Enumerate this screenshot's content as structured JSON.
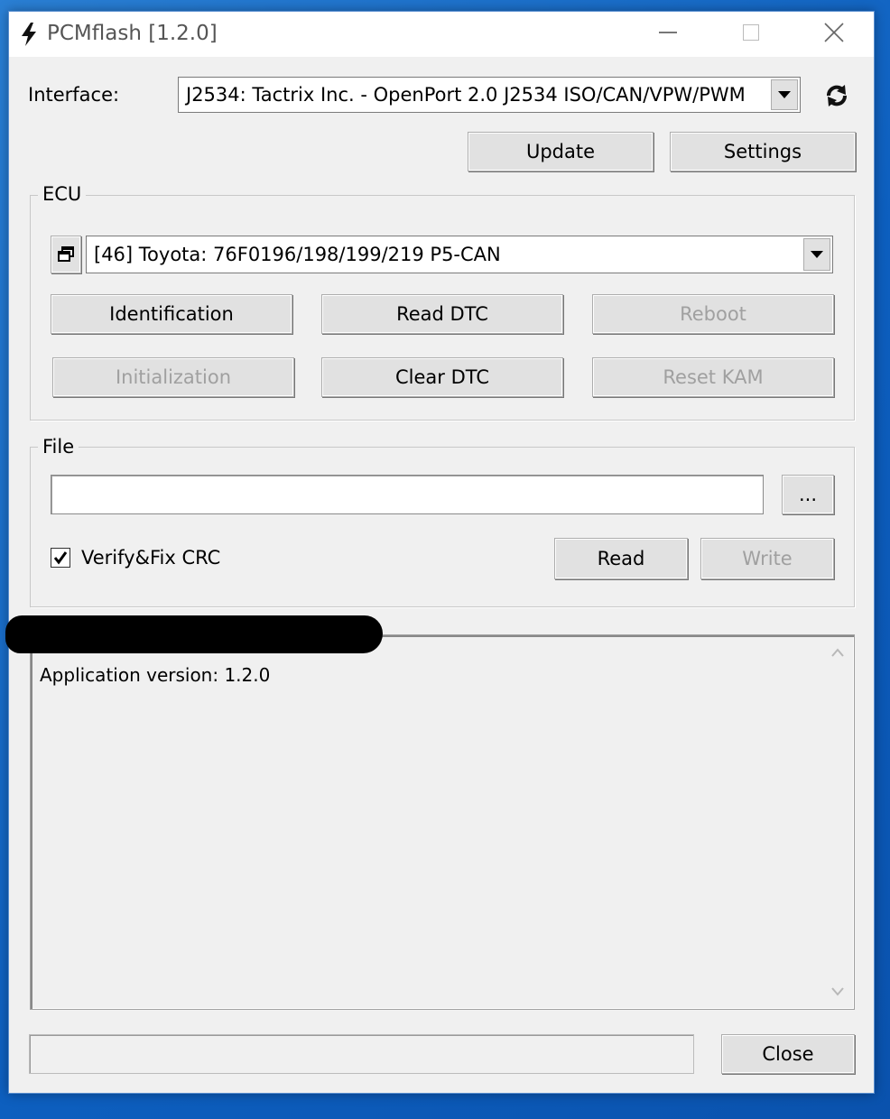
{
  "window": {
    "title": "PCMflash [1.2.0]",
    "icons": {
      "app": "lightning-icon",
      "minimize": "minimize-icon",
      "maximize": "maximize-icon",
      "close": "close-icon"
    }
  },
  "interface": {
    "label": "Interface:",
    "selected": "J2534: Tactrix Inc. - OpenPort 2.0 J2534 ISO/CAN/VPW/PWM",
    "refresh_icon": "refresh-icon"
  },
  "top_buttons": {
    "update": "Update",
    "settings": "Settings"
  },
  "ecu": {
    "group_title": "ECU",
    "selected": "[46] Toyota: 76F0196/198/199/219 P5-CAN",
    "window_icon": "restore-window-icon",
    "buttons": {
      "identification": "Identification",
      "read_dtc": "Read DTC",
      "reboot": "Reboot",
      "initialization": "Initialization",
      "clear_dtc": "Clear DTC",
      "reset_kam": "Reset KAM"
    }
  },
  "file": {
    "group_title": "File",
    "path_value": "",
    "browse_label": "...",
    "verify_crc_label": "Verify&Fix CRC",
    "verify_crc_checked": true,
    "read_label": "Read",
    "write_label": "Write"
  },
  "log": {
    "lines": [
      "Application version: 1.2.0"
    ]
  },
  "footer": {
    "close_label": "Close"
  },
  "colors": {
    "desktop": "#0d5fbf",
    "window_bg": "#f0f0f0",
    "disabled_text": "#a0a0a0"
  }
}
